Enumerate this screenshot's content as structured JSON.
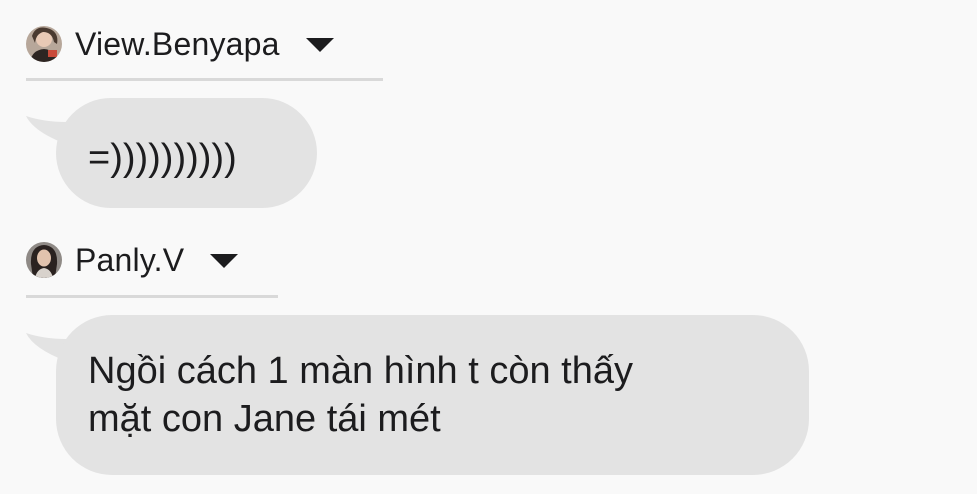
{
  "messages": [
    {
      "sender": "View.Benyapa",
      "avatar_icon": "profile-photo-icon",
      "text": "=))))))))))"
    },
    {
      "sender": "Panly.V",
      "avatar_icon": "profile-photo-icon",
      "text_lines": [
        "Ngồi cách 1 màn hình t còn thấy",
        "mặt con Jane tái mét"
      ]
    }
  ],
  "colors": {
    "background": "#f9f9f9",
    "bubble": "#e3e3e3",
    "divider": "#d9d9d9",
    "text": "#1c1c1e"
  }
}
